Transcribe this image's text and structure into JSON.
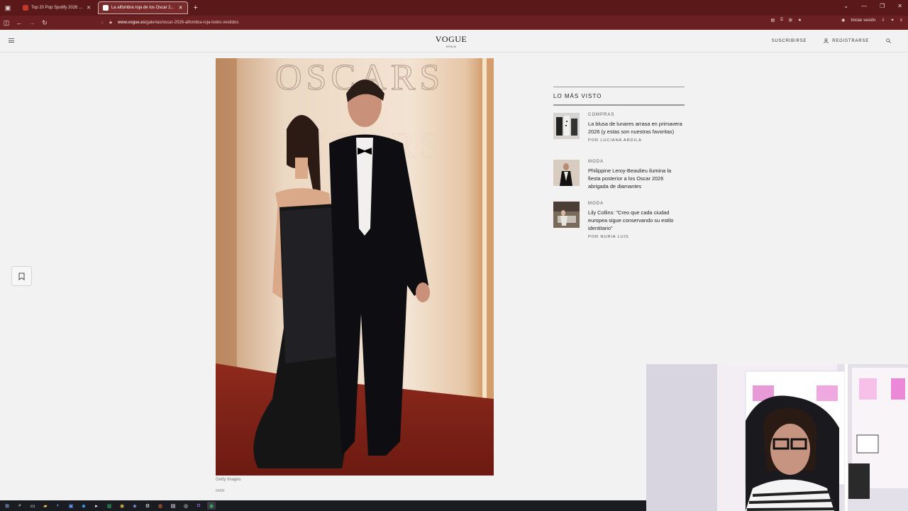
{
  "browser": {
    "tabs": [
      {
        "label": "Top 20 Pop Spotify 2026 ..."
      },
      {
        "label": "La alfombra roja de los Oscar 2..."
      }
    ],
    "url_domain": "www.vogue.es",
    "url_path": "/galerias/oscar-2026-alfombra-roja-looks-vestidos",
    "signin_label": "Iniciar sesión"
  },
  "site": {
    "logo": "VOGUE",
    "logo_sub": "SPAIN",
    "nav": {
      "subscribe": "SUSCRIBIRSE",
      "register": "REGISTRARSE"
    }
  },
  "gallery": {
    "caption": "Getty Images",
    "counter": "64/85"
  },
  "most_viewed": {
    "heading": "LO MÁS VISTO",
    "items": [
      {
        "category": "COMPRAS",
        "title": "La blusa de lunares arrasa en primavera 2026 (y estas son nuestras favoritas)",
        "author": "POR LUCIANA ARDILA"
      },
      {
        "category": "MODA",
        "title": "Philippine Leroy-Beaulieu ilumina la fiesta posterior a los Oscar 2026 abrigada de diamantes",
        "author": ""
      },
      {
        "category": "MODA",
        "title": "Lily Collins: \"Creo que cada ciudad europea sigue conservando su estilo identitario\"",
        "author": "POR NURIA LUIS"
      }
    ]
  }
}
